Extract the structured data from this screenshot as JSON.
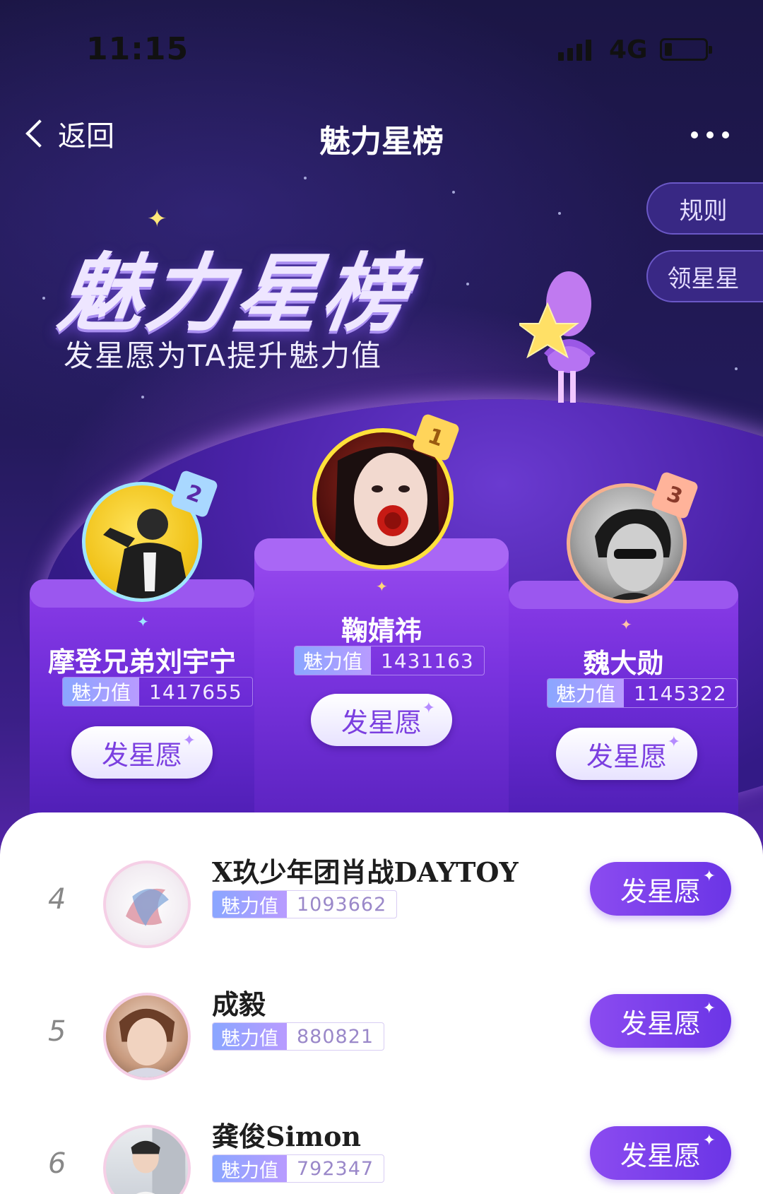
{
  "status_bar": {
    "time": "11:15",
    "network": "4G"
  },
  "nav": {
    "back_label": "返回",
    "title": "魅力星榜"
  },
  "side": {
    "rules": "规则",
    "collect_stars": "领星星"
  },
  "hero": {
    "title": "魅力星榜",
    "subtitle": "发星愿为TA提升魅力值"
  },
  "charm_label": "魅力值",
  "wish_label": "发星愿",
  "podium": [
    {
      "rank": "1",
      "name": "鞠婧祎",
      "charm": "1431163"
    },
    {
      "rank": "2",
      "name": "摩登兄弟刘宇宁",
      "charm": "1417655"
    },
    {
      "rank": "3",
      "name": "魏大勋",
      "charm": "1145322"
    }
  ],
  "list": [
    {
      "rank": "4",
      "name": "X玖少年团肖战DAYTOY",
      "charm": "1093662"
    },
    {
      "rank": "5",
      "name": "成毅",
      "charm": "880821"
    },
    {
      "rank": "6",
      "name": "龚俊Simon",
      "charm": "792347"
    }
  ],
  "colors": {
    "accent": "#7b3fe0",
    "bg_dark": "#1b1645",
    "podium": "#6c2bd6"
  }
}
